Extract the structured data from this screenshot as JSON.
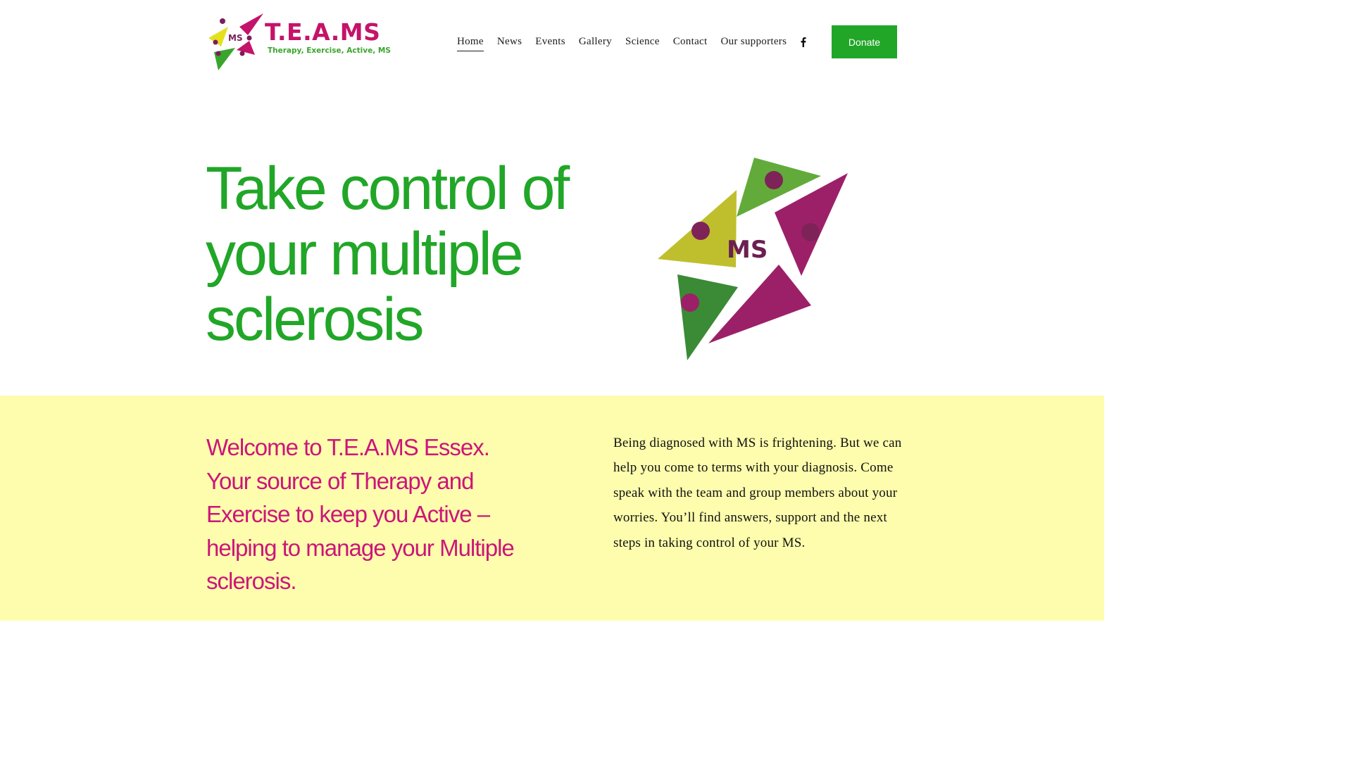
{
  "logo": {
    "title": "T.E.A.MS",
    "tagline": "Therapy, Exercise, Active, MS",
    "badge": "MS"
  },
  "nav": {
    "items": [
      {
        "label": "Home",
        "active": true
      },
      {
        "label": "News"
      },
      {
        "label": "Events"
      },
      {
        "label": "Gallery"
      },
      {
        "label": "Science"
      },
      {
        "label": "Contact"
      },
      {
        "label": "Our supporters"
      }
    ],
    "social_icon": "facebook-icon",
    "donate_label": "Donate"
  },
  "hero": {
    "title": "Take control of your multiple sclerosis",
    "image_text": "MS"
  },
  "welcome": {
    "heading": "Welcome to T.E.A.MS Essex. Your source of Therapy and Exercise to keep you Active – helping to manage your Multiple sclerosis.",
    "body": "Being diagnosed with MS is frightening. But we can help you come to terms with your diagnosis. Come speak with the team and group members about your worries. You’ll find answers, support and the next steps in taking control of your MS."
  },
  "colors": {
    "brand_green": "#21a628",
    "brand_magenta": "#cc1579",
    "band_yellow": "#fdfdad"
  }
}
